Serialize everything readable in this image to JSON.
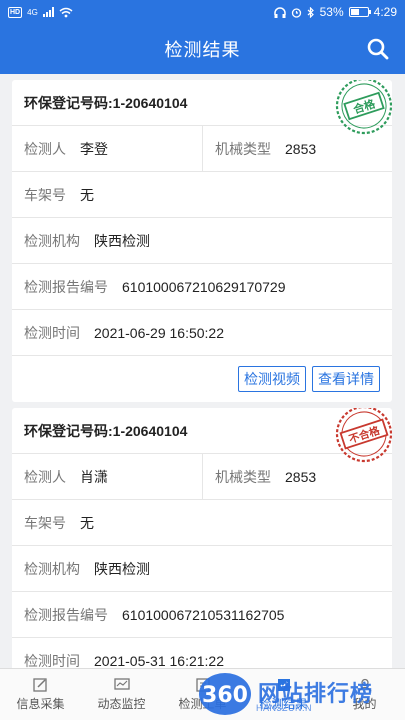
{
  "status": {
    "net_label": "HD",
    "net_type": "4G",
    "battery": "53%",
    "battery_level": 0.53,
    "time": "4:29"
  },
  "header": {
    "title": "检测结果"
  },
  "records": [
    {
      "title": "环保登记号码:1-20640104",
      "inspector_label": "检测人",
      "inspector": "李登",
      "machine_type_label": "机械类型",
      "machine_type": "2853",
      "frame_label": "车架号",
      "frame": "无",
      "agency_label": "检测机构",
      "agency": "陕西检测",
      "report_label": "检测报告编号",
      "report": "610100067210629170729",
      "time_label": "检测时间",
      "time": "2021-06-29 16:50:22",
      "stamp": "合格",
      "stamp_color": "#2e9c5c",
      "video_button": "检测视频",
      "detail_button": "查看详情"
    },
    {
      "title": "环保登记号码:1-20640104",
      "inspector_label": "检测人",
      "inspector": "肖潇",
      "machine_type_label": "机械类型",
      "machine_type": "2853",
      "frame_label": "车架号",
      "frame": "无",
      "agency_label": "检测机构",
      "agency": "陕西检测",
      "report_label": "检测报告编号",
      "report": "610100067210531162705",
      "time_label": "检测时间",
      "time": "2021-05-31 16:21:22",
      "stamp": "不合格",
      "stamp_color": "#c8392f"
    }
  ],
  "nav": [
    {
      "label": "信息采集",
      "icon": "edit-icon"
    },
    {
      "label": "动态监控",
      "icon": "monitor-icon"
    },
    {
      "label": "检测工单",
      "icon": "clipboard-icon"
    },
    {
      "label": "检测结果",
      "icon": "result-icon"
    },
    {
      "label": "我的",
      "icon": "person-icon"
    }
  ],
  "watermark": {
    "badge": "360",
    "text": "网站排行榜",
    "sub": "HAN3ZUN.N"
  },
  "colors": {
    "primary": "#2a74e0",
    "pass": "#2e9c5c",
    "fail": "#c8392f"
  }
}
